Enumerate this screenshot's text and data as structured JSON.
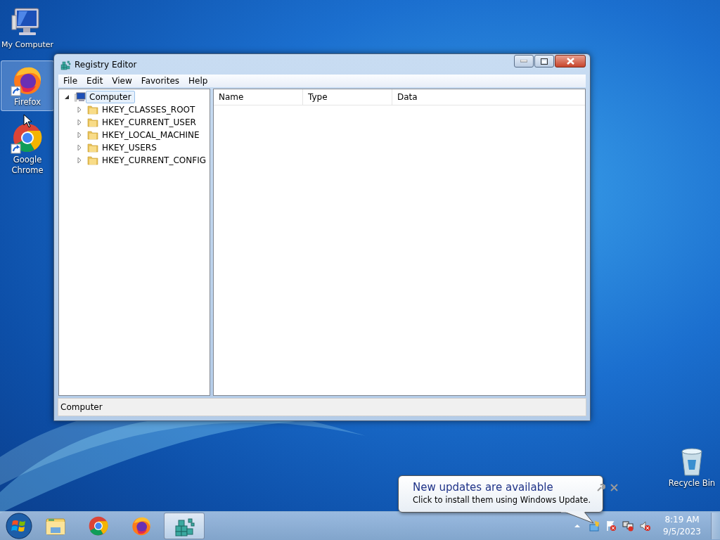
{
  "desktop_icons": [
    {
      "label": "My Computer",
      "kind": "computer",
      "selected": false
    },
    {
      "label": "Firefox",
      "kind": "firefox",
      "selected": true
    },
    {
      "label": "Google Chrome",
      "kind": "chrome",
      "selected": false
    }
  ],
  "recycle_bin": {
    "label": "Recycle Bin",
    "kind": "recycle",
    "selected": false
  },
  "window": {
    "title": "Registry Editor",
    "menu": [
      "File",
      "Edit",
      "View",
      "Favorites",
      "Help"
    ],
    "tree": {
      "label": "Computer",
      "expanded": true,
      "selected": true,
      "children": [
        {
          "label": "HKEY_CLASSES_ROOT",
          "expanded": false,
          "selected": false
        },
        {
          "label": "HKEY_CURRENT_USER",
          "expanded": false,
          "selected": false
        },
        {
          "label": "HKEY_LOCAL_MACHINE",
          "expanded": false,
          "selected": false
        },
        {
          "label": "HKEY_USERS",
          "expanded": false,
          "selected": false
        },
        {
          "label": "HKEY_CURRENT_CONFIG",
          "expanded": false,
          "selected": false
        }
      ]
    },
    "columns": [
      "Name",
      "Type",
      "Data"
    ],
    "status_bar": "Computer"
  },
  "notification": {
    "title": "New updates are available",
    "message": "Click to install them using Windows Update."
  },
  "taskbar": {
    "items": [
      {
        "kind": "explorer",
        "active": false
      },
      {
        "kind": "chrome",
        "active": false
      },
      {
        "kind": "firefox",
        "active": false
      },
      {
        "kind": "regedit",
        "active": true
      }
    ],
    "clock": {
      "time": "8:19 AM",
      "date": "9/5/2023"
    }
  }
}
